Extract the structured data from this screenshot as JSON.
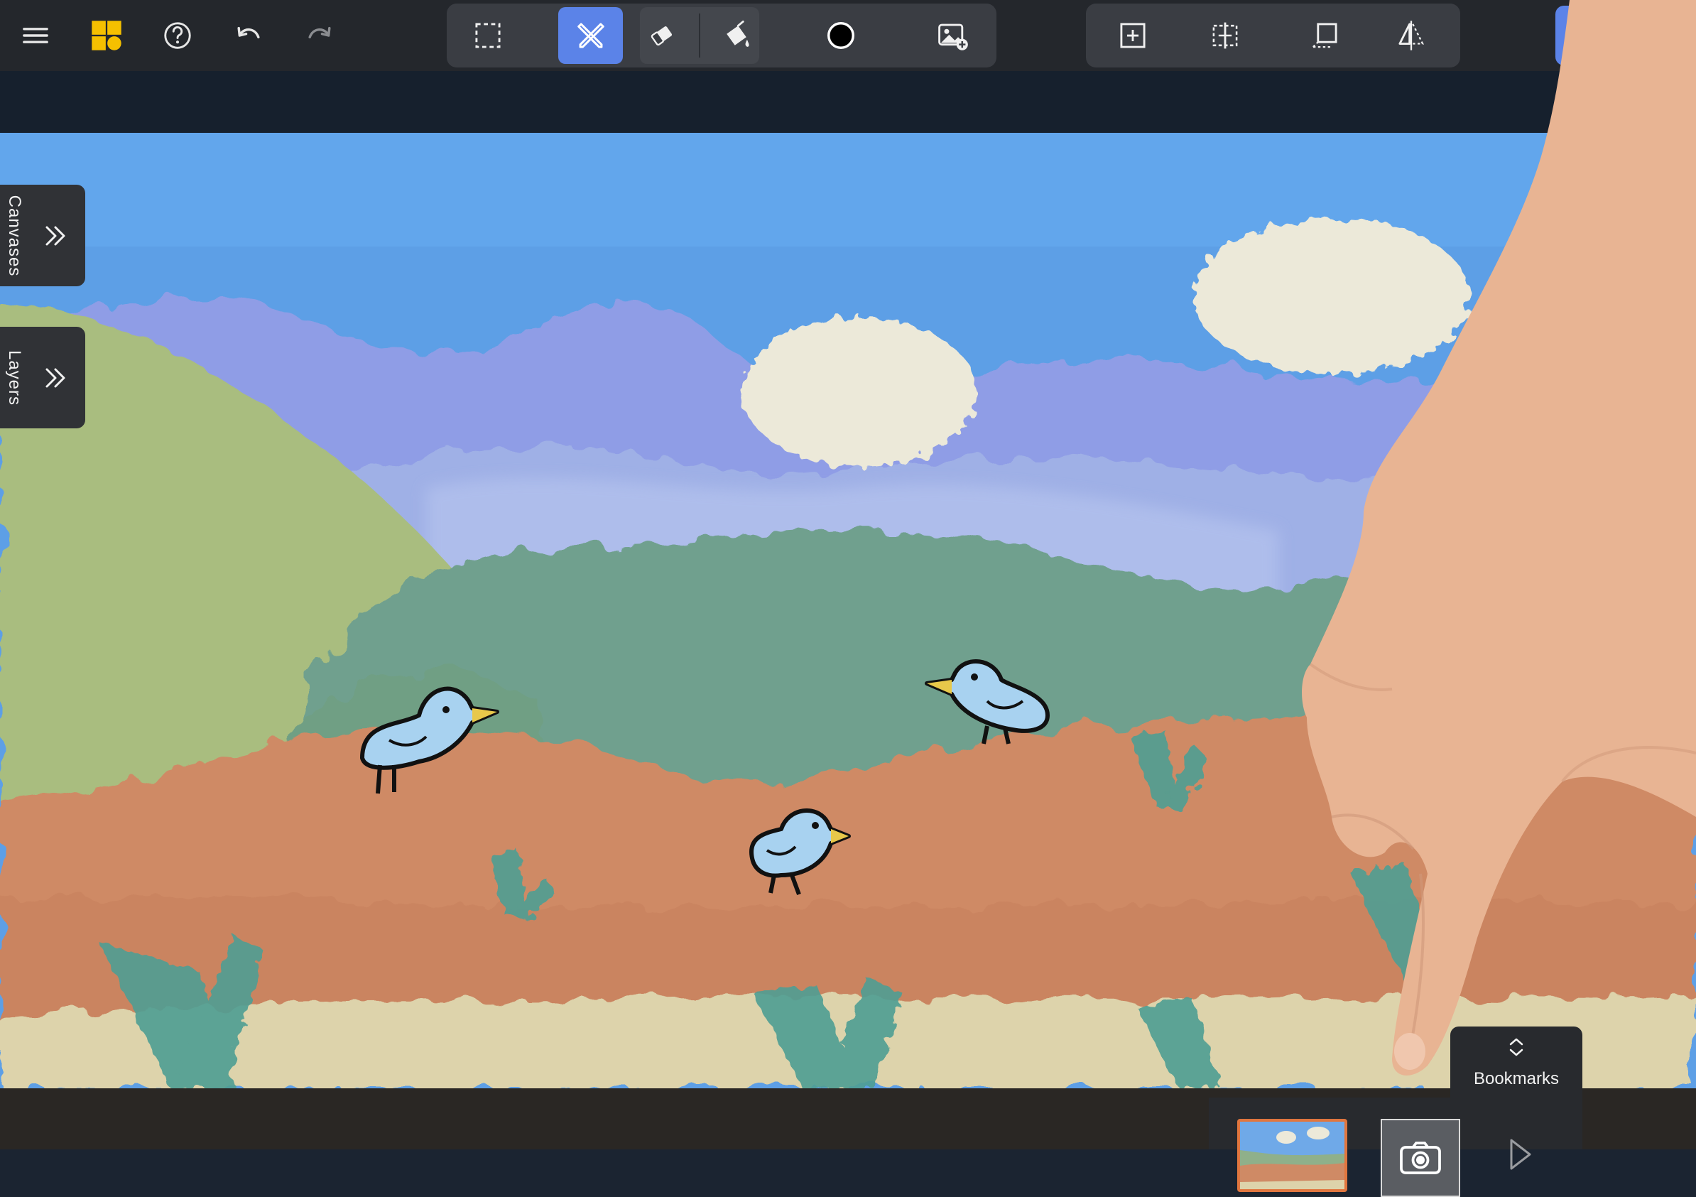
{
  "toolbar": {
    "icons": [
      "menu-icon",
      "app-logo-icon",
      "help-icon",
      "undo-icon",
      "redo-icon"
    ],
    "tools": [
      "selection-icon",
      "pencil-ruler-icon",
      "eraser-icon",
      "fill-bucket-icon",
      "color-dot-icon",
      "add-image-icon"
    ],
    "canvas_tools": [
      "add-frame-icon",
      "resize-icon",
      "perspective-icon",
      "flip-icon"
    ],
    "accent": "#5b83e8",
    "brush_color": "#000000"
  },
  "side_panels": {
    "canvases_label": "Canvases",
    "layers_label": "Layers"
  },
  "bookmarks": {
    "label": "Bookmarks"
  }
}
